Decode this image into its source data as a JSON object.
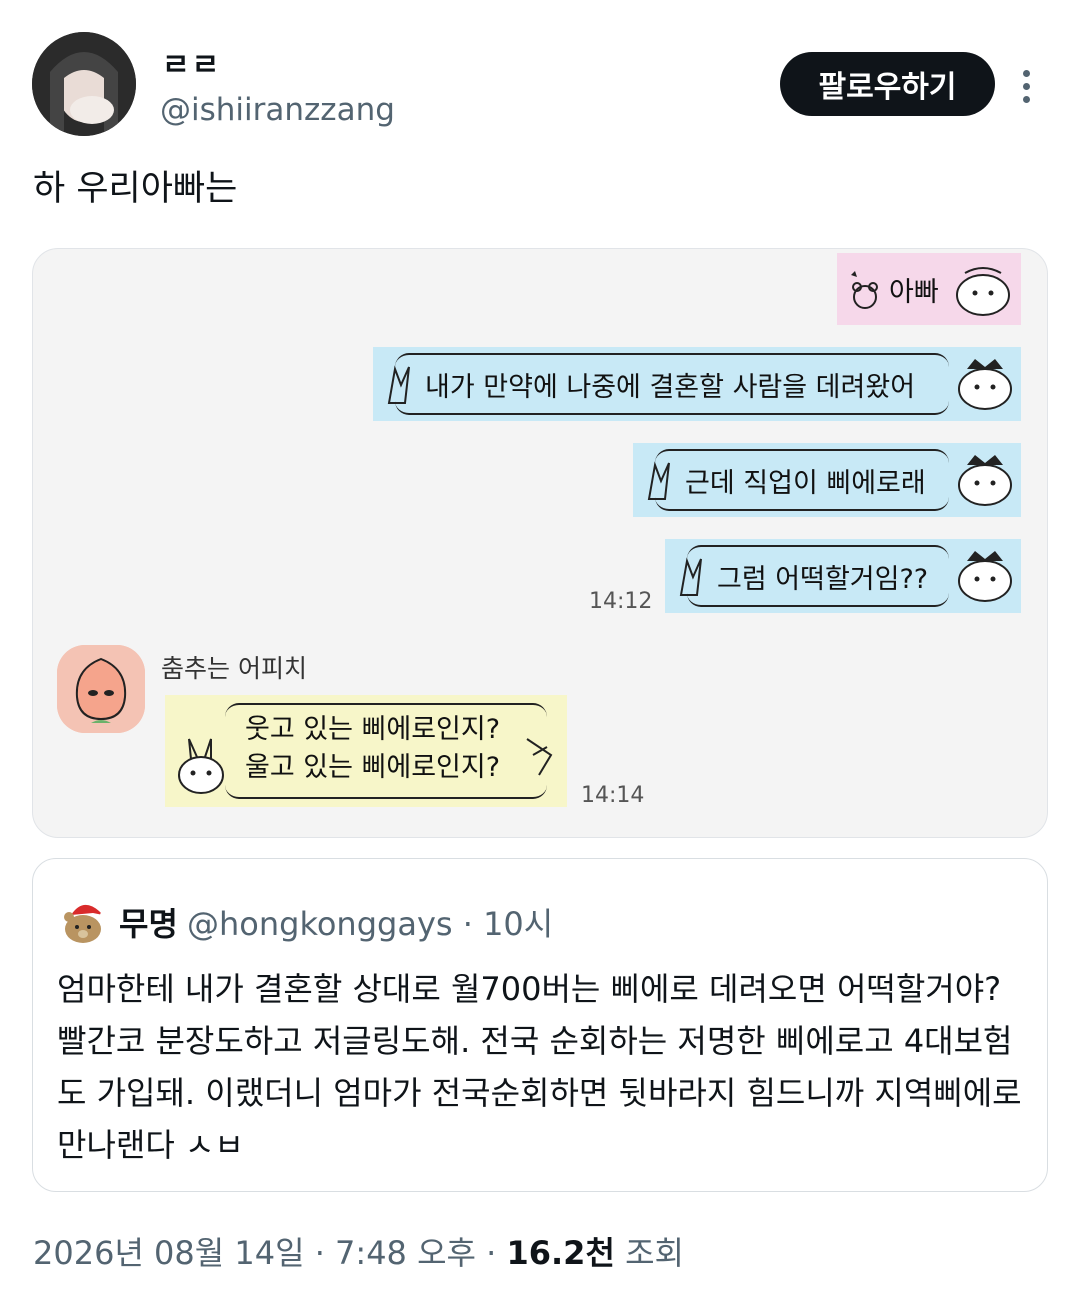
{
  "author": {
    "display_name": "ㄹㄹ",
    "handle": "@ishiiranzzang",
    "follow_label": "팔로우하기"
  },
  "tweet": {
    "text": "하 우리아빠는"
  },
  "chat": {
    "header_label": "아빠",
    "sent_messages": [
      "내가 만약에 나중에 결혼할 사람을 데려왔어",
      "근데 직업이 삐에로래",
      "그럼 어떡할거임??"
    ],
    "sent_time": "14:12",
    "reply_sender": "춤추는 어피치",
    "reply_lines": [
      "웃고 있는 삐에로인지?",
      "울고 있는 삐에로인지?"
    ],
    "reply_time": "14:14"
  },
  "quote": {
    "name": "무명",
    "handle_time": "@hongkonggays · 10시",
    "text": "엄마한테 내가 결혼할 상대로 월700버는 삐에로 데려오면 어떡할거야? 빨간코 분장도하고 저글링도해. 전국 순회하는 저명한 삐에로고 4대보험도 가입돼. 이랬더니 엄마가 전국순회하면 뒷바라지 힘드니까 지역삐에로만나랜다 ㅅㅂ"
  },
  "meta": {
    "datetime": "2026년 08월 14일 · 7:48 오후",
    "separator": " · ",
    "views_count": "16.2천",
    "views_label": " 조회"
  },
  "colors": {
    "follow_button": "#0f1419",
    "chat_background": "#f4f4f4",
    "pink_bubble": "#f6d8ea",
    "blue_bubble": "#c8e9f6",
    "yellow_bubble": "#f7f6c9",
    "muted_text": "#536471"
  },
  "icons": [
    "user-avatar",
    "more-options-icon",
    "bunny-sticker-icon",
    "cat-sticker-icon",
    "apeach-avatar-icon",
    "bear-santa-avatar-icon"
  ]
}
